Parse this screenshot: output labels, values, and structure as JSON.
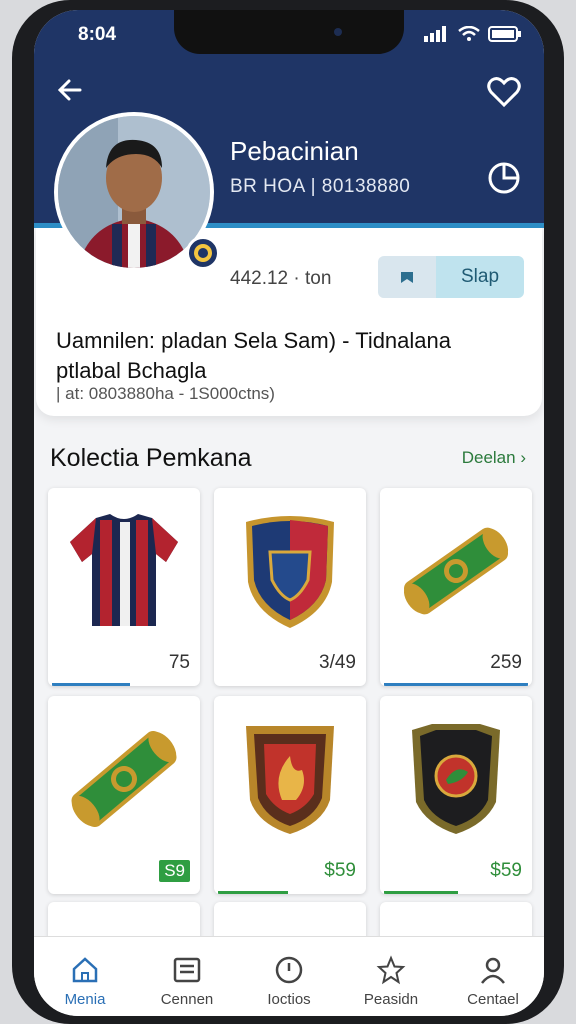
{
  "status_bar": {
    "time": "8:04"
  },
  "profile": {
    "name": "Pebacinian",
    "subline": "BR HOA | 80138880",
    "stat": "442.12 · ton",
    "action_label": "Slap",
    "bio": "Uamnilen: pladan Sela Sam) - Tidnalana ptlabal Bchagla",
    "meta": "| at: 0803880ha - 1S000ctns)"
  },
  "collection": {
    "title": "Kolectia Pemkana",
    "see_all": "Deelan",
    "items": [
      {
        "kind": "jersey",
        "price": "75"
      },
      {
        "kind": "shield-badge",
        "price": "3/49"
      },
      {
        "kind": "roll-card",
        "price": "259"
      },
      {
        "kind": "roll-card",
        "price": "S9"
      },
      {
        "kind": "fire-badge",
        "price": "$59"
      },
      {
        "kind": "dark-badge",
        "price": "$59"
      }
    ]
  },
  "tabs": [
    {
      "label": "Menia",
      "icon": "home-icon"
    },
    {
      "label": "Cennen",
      "icon": "list-icon"
    },
    {
      "label": "Ioctios",
      "icon": "clock-icon"
    },
    {
      "label": "Peasidn",
      "icon": "star-icon"
    },
    {
      "label": "Centael",
      "icon": "user-icon"
    }
  ],
  "colors": {
    "header": "#1f3566",
    "accent": "#2e8fc7",
    "green": "#2f8e3a"
  }
}
